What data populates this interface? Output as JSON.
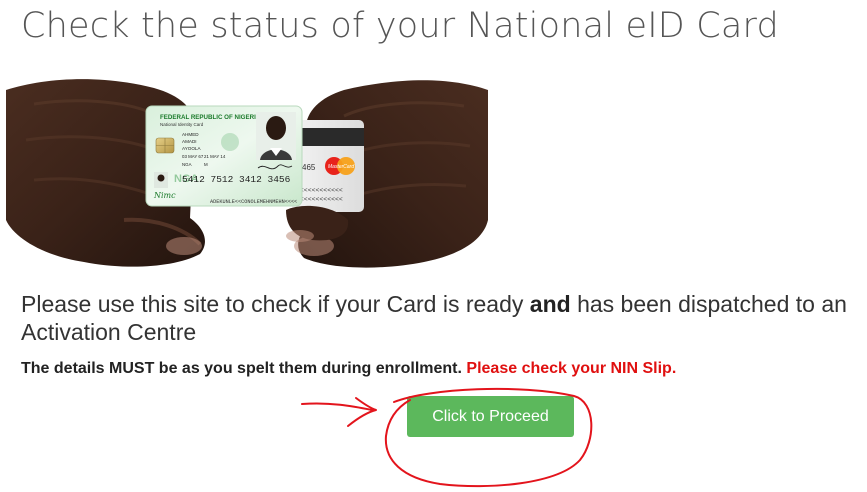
{
  "page": {
    "title": "Check the status of your National eID Card"
  },
  "hero_card": {
    "country": "FEDERAL REPUBLIC OF NIGERIA",
    "card_type": "National Identity Card",
    "surname": "AHMED",
    "given_name": "AMADI",
    "middle_name": "AYOOLA",
    "dob": "03 MAY 67",
    "sex": "M",
    "issue_date": "21 MAY 14",
    "nationality": "NGA",
    "card_number": "5412  7512  3412  3456",
    "mrz": "ADEKUNLE<<CONOLEMEHNMEHN<<<<",
    "mrz_right": "<<<<<<<<<<<<",
    "brand": "MasterCard",
    "back_number": "465",
    "nimc_label": "Nimc",
    "nga_label": "NGA"
  },
  "content": {
    "intro_pre": "Please use this site to check if your Card is ready ",
    "intro_bold": "and",
    "intro_post": " has been dispatched to an Activation Centre",
    "notice_main": "The details MUST be as you spelt them during enrollment. ",
    "notice_warn": "Please check your NIN Slip."
  },
  "actions": {
    "proceed_label": "Click to Proceed"
  },
  "colors": {
    "button": "#5cb85c",
    "warning": "#e01010",
    "annotation": "#e3141c"
  }
}
